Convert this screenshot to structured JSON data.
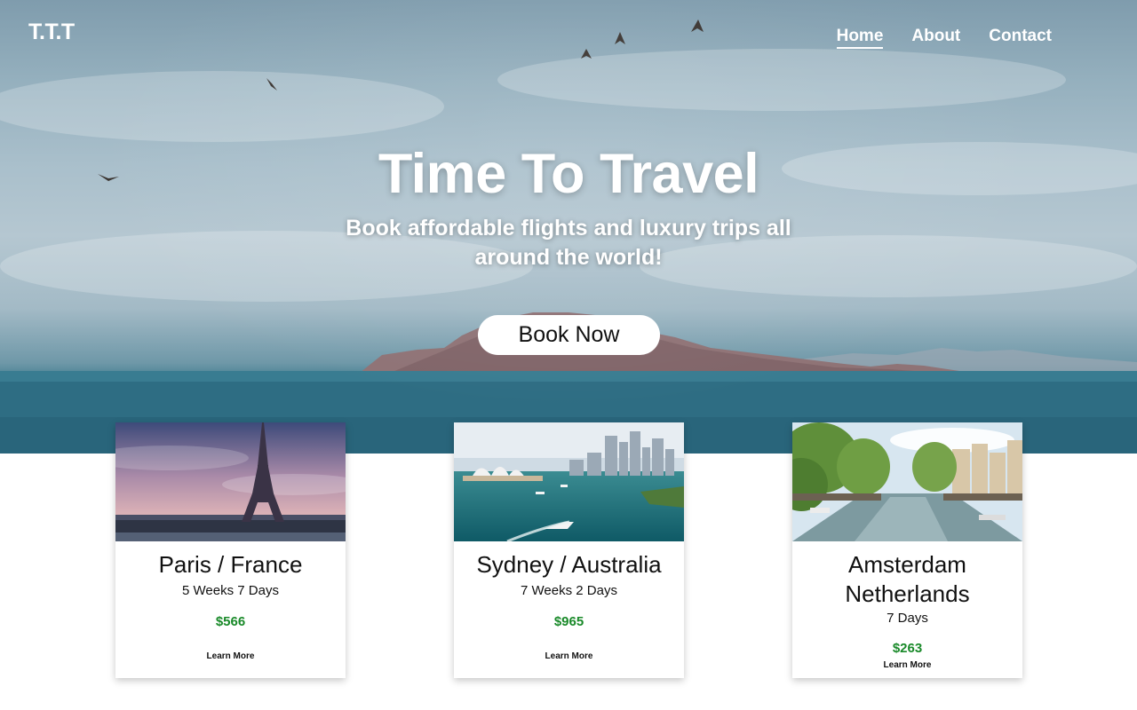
{
  "brand": {
    "logo": "T.T.T"
  },
  "nav": {
    "items": [
      {
        "label": "Home",
        "active": true
      },
      {
        "label": "About",
        "active": false
      },
      {
        "label": "Contact",
        "active": false
      }
    ]
  },
  "hero": {
    "title": "Time To Travel",
    "subtitle": "Book affordable flights and luxury trips all around the world!",
    "cta_label": "Book Now"
  },
  "trips": [
    {
      "name": "Paris / France",
      "duration": "5 Weeks 7 Days",
      "price": "$566",
      "link_label": "Learn More"
    },
    {
      "name": "Sydney / Australia",
      "duration": "7 Weeks 2 Days",
      "price": "$965",
      "link_label": "Learn More"
    },
    {
      "name": "Amsterdam Netherlands",
      "duration": "7 Days",
      "price": "$263",
      "link_label": "Learn More"
    }
  ],
  "colors": {
    "price": "#1a8a2a",
    "hero_sea": "#2f6e84",
    "card_bg": "#ffffff"
  }
}
